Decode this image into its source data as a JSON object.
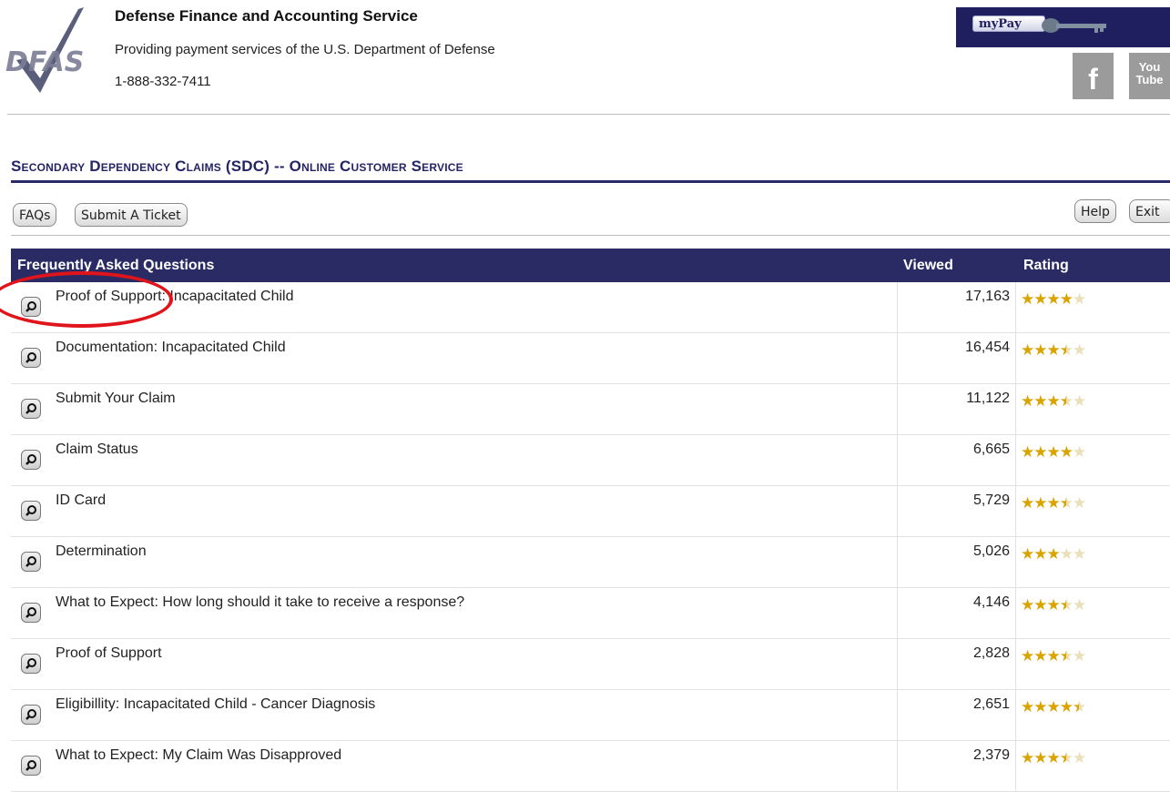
{
  "header": {
    "org_name": "Defense Finance and Accounting Service",
    "tagline": "Providing payment services of the U.S. Department of Defense",
    "phone": "1-888-332-7411",
    "logo_text": "DFAS",
    "mypay_label": "myPay",
    "facebook_label": "f",
    "youtube_label": "You Tube"
  },
  "page_title": "Secondary Dependency Claims (SDC) -- Online Customer Service",
  "nav": {
    "faqs": "FAQs",
    "submit_ticket": "Submit A Ticket",
    "help": "Help",
    "exit": "Exit"
  },
  "table": {
    "headers": {
      "question": "Frequently Asked Questions",
      "viewed": "Viewed",
      "rating": "Rating"
    },
    "rows": [
      {
        "question": "Proof of Support: Incapacitated Child",
        "viewed": "17,163",
        "rating": 4
      },
      {
        "question": "Documentation: Incapacitated Child",
        "viewed": "16,454",
        "rating": 3.5
      },
      {
        "question": "Submit Your Claim",
        "viewed": "11,122",
        "rating": 3.5
      },
      {
        "question": "Claim Status",
        "viewed": "6,665",
        "rating": 4
      },
      {
        "question": "ID Card",
        "viewed": "5,729",
        "rating": 3.5
      },
      {
        "question": "Determination",
        "viewed": "5,026",
        "rating": 3
      },
      {
        "question": "What to Expect: How long should it take to receive a response?",
        "viewed": "4,146",
        "rating": 3.5
      },
      {
        "question": "Proof of Support",
        "viewed": "2,828",
        "rating": 3.5
      },
      {
        "question": "Eligibillity: Incapacitated Child - Cancer Diagnosis",
        "viewed": "2,651",
        "rating": 4.5
      },
      {
        "question": "What to Expect: My Claim Was Disapproved",
        "viewed": "2,379",
        "rating": 3.5
      }
    ]
  },
  "colors": {
    "header_bg": "#2a2a64",
    "title_color": "#252566",
    "star_color": "#d9a300",
    "annotation_color": "#e0141b"
  },
  "icons": {
    "row_button": "magnifier-icon",
    "star": "star-icon"
  }
}
